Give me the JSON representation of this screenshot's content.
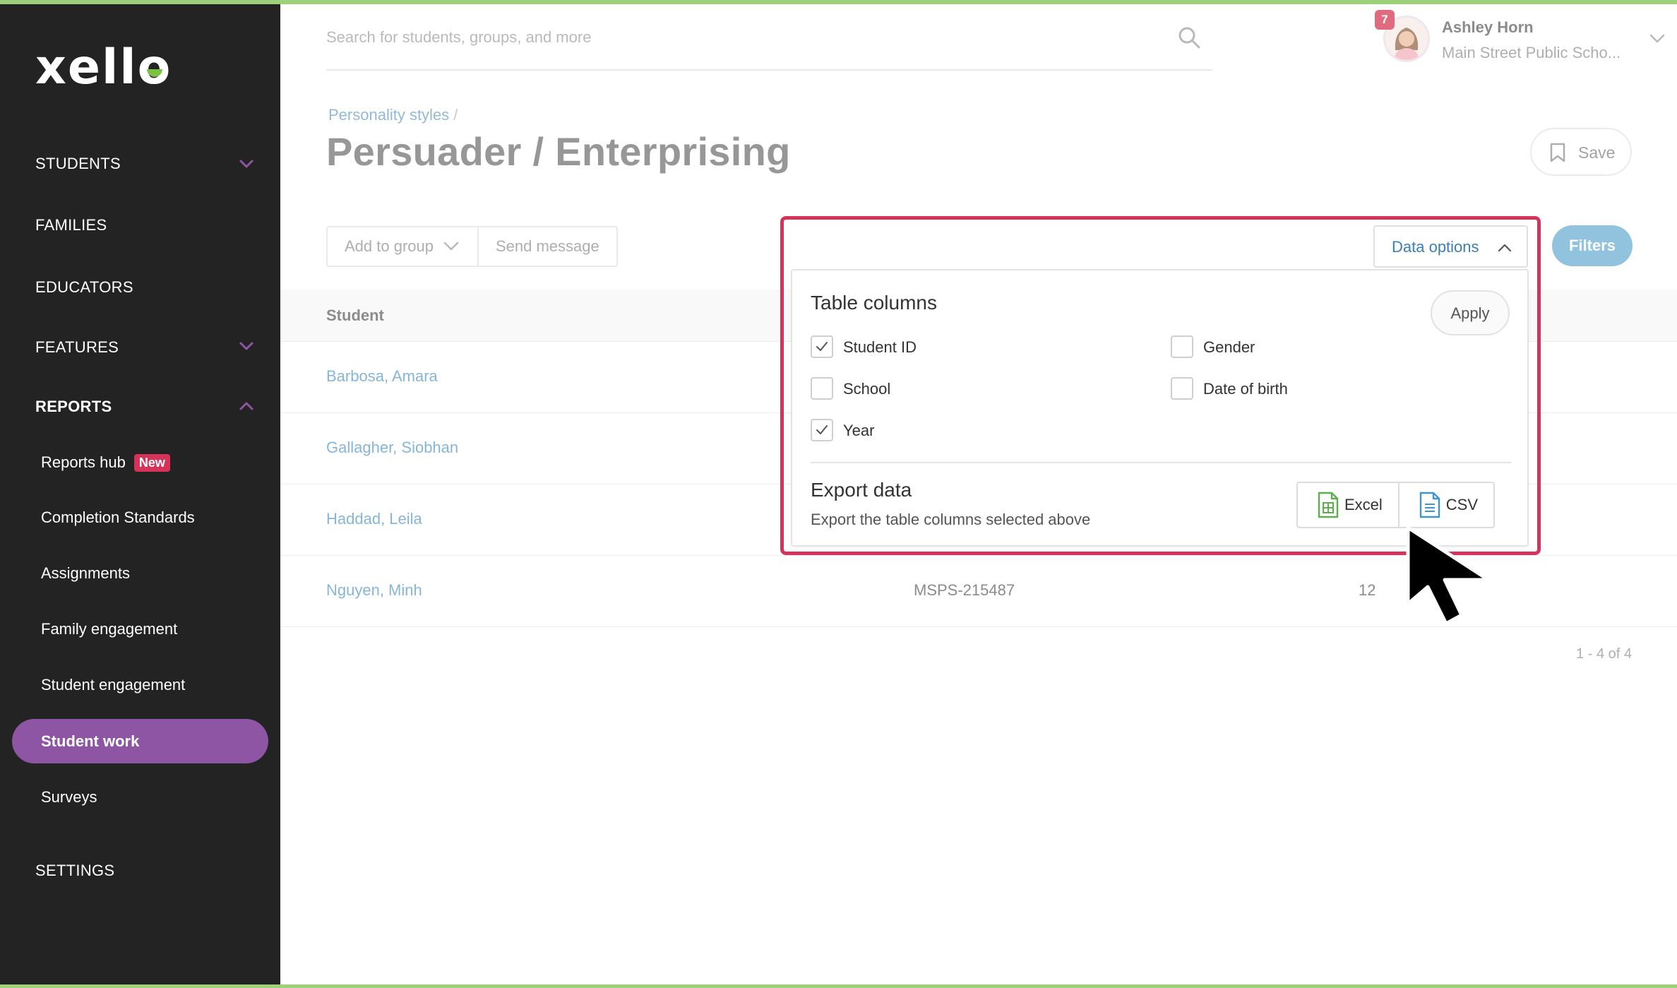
{
  "brand": {
    "logo": "xello",
    "accent": "#8d55a3",
    "highlight": "#d6335a",
    "link": "#4c94c8"
  },
  "sidebar": {
    "items": [
      {
        "label": "STUDENTS",
        "has_chevron": "down"
      },
      {
        "label": "FAMILIES"
      },
      {
        "label": "EDUCATORS"
      },
      {
        "label": "FEATURES",
        "has_chevron": "down"
      },
      {
        "label": "REPORTS",
        "has_chevron": "up",
        "expanded": true
      },
      {
        "label": "SETTINGS"
      }
    ],
    "reports_sub": [
      {
        "label": "Reports hub",
        "badge": "New"
      },
      {
        "label": "Completion Standards"
      },
      {
        "label": "Assignments"
      },
      {
        "label": "Family engagement"
      },
      {
        "label": "Student engagement"
      },
      {
        "label": "Student work",
        "active": true
      },
      {
        "label": "Surveys"
      }
    ]
  },
  "header": {
    "search_placeholder": "Search for students, groups, and more",
    "notifications": "7",
    "user_name": "Ashley Horn",
    "user_school": "Main Street Public Scho..."
  },
  "page": {
    "breadcrumb": "Personality styles",
    "breadcrumb_sep": "/",
    "title": "Persuader / Enterprising",
    "save_label": "Save"
  },
  "toolbar": {
    "add_to_group": "Add to group",
    "send_message": "Send message",
    "data_options": "Data options",
    "filters": "Filters"
  },
  "table": {
    "header": "Student",
    "rows": [
      {
        "name": "Barbosa, Amara",
        "student_id": "",
        "year": ""
      },
      {
        "name": "Gallagher, Siobhan",
        "student_id": "",
        "year": ""
      },
      {
        "name": "Haddad, Leila",
        "student_id": "",
        "year": ""
      },
      {
        "name": "Nguyen, Minh",
        "student_id": "MSPS-215487",
        "year": "12"
      }
    ],
    "pagination": "1 - 4 of 4"
  },
  "data_options_panel": {
    "table_columns_title": "Table columns",
    "apply_label": "Apply",
    "columns": [
      {
        "label": "Student ID",
        "checked": true
      },
      {
        "label": "Gender",
        "checked": false
      },
      {
        "label": "School",
        "checked": false
      },
      {
        "label": "Date of birth",
        "checked": false
      },
      {
        "label": "Year",
        "checked": true
      }
    ],
    "export_title": "Export data",
    "export_subtitle": "Export the table columns selected above",
    "export_excel": "Excel",
    "export_csv": "CSV"
  }
}
